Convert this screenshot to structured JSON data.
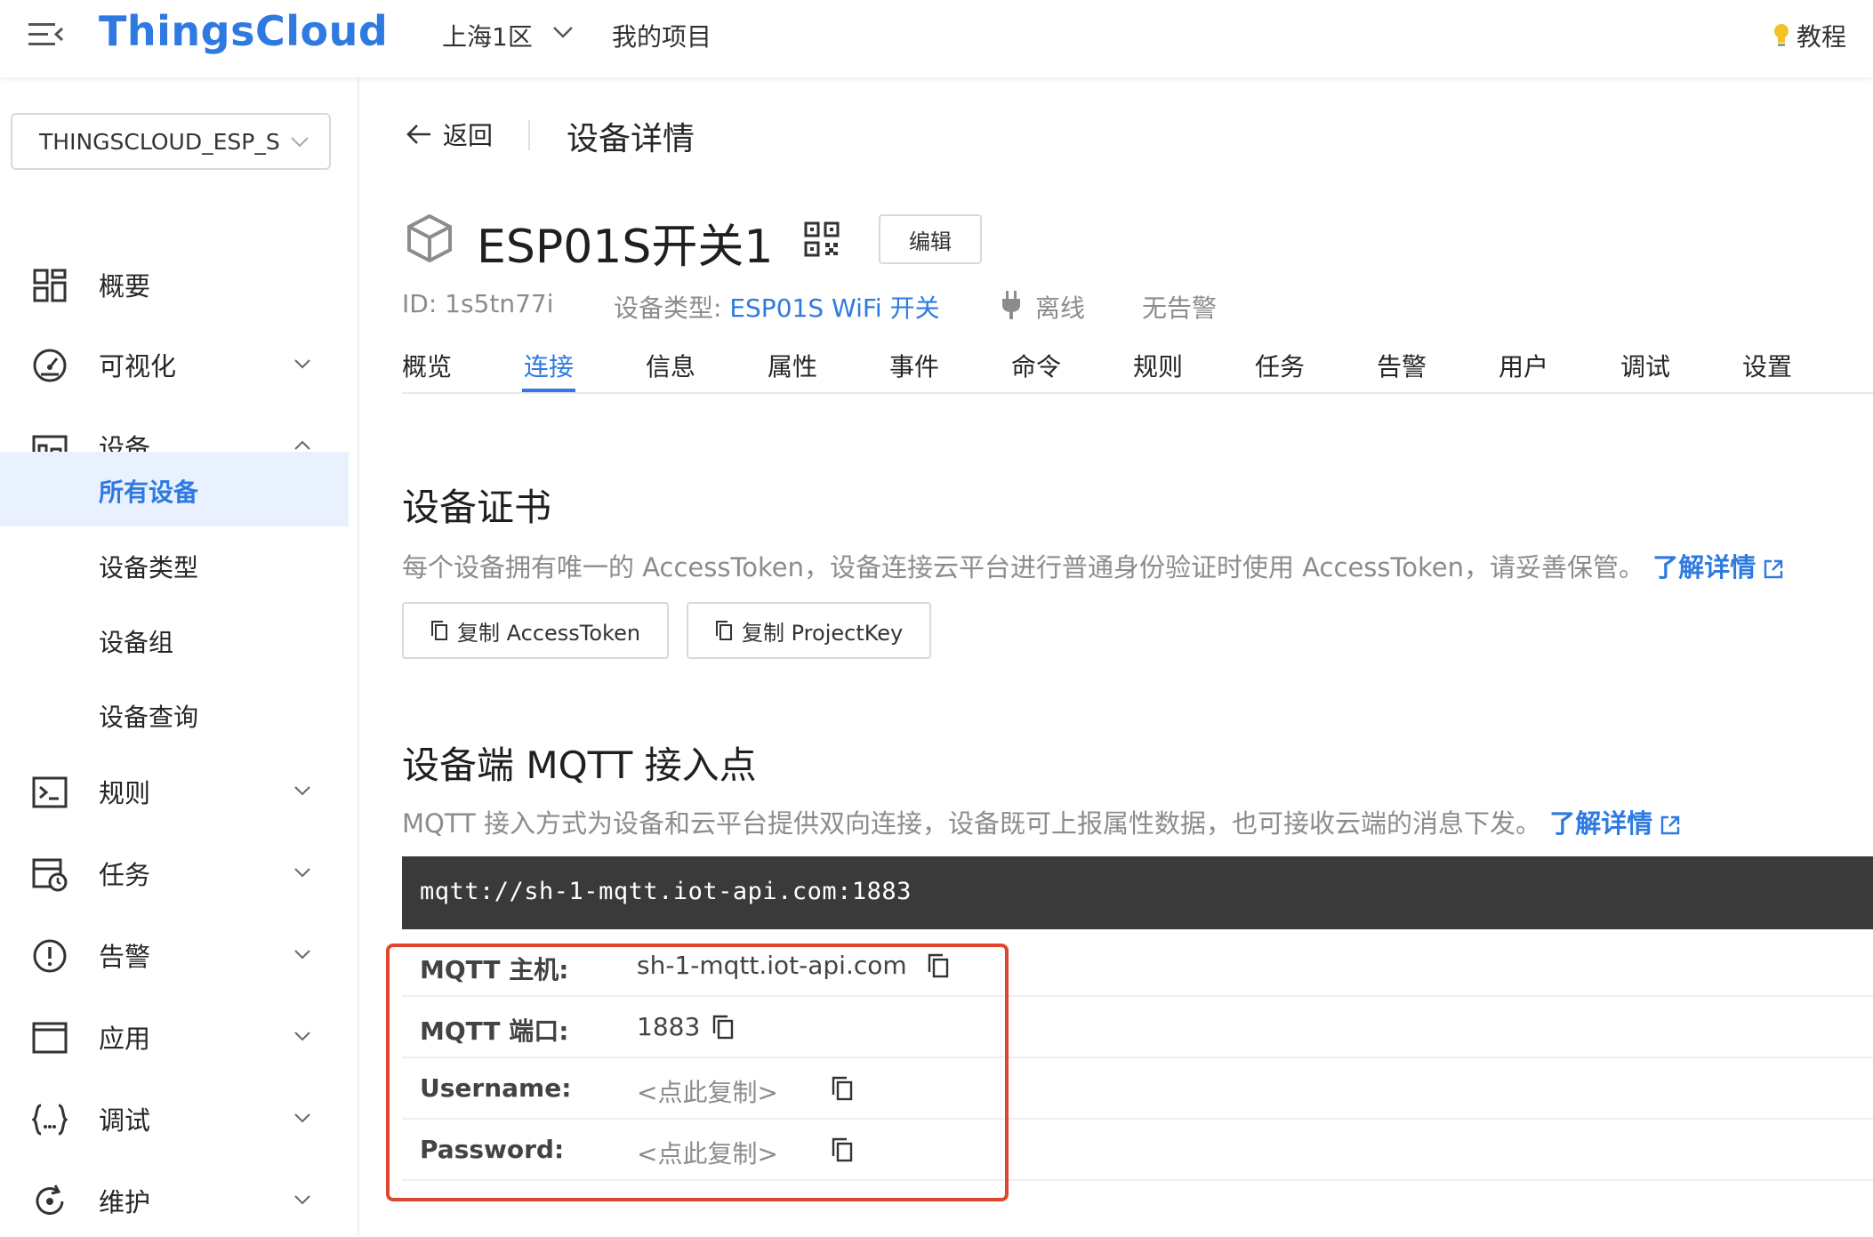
{
  "topbar": {
    "logo": "ThingsCloud",
    "region": "上海1区",
    "projects": "我的项目",
    "tutorial": "教程"
  },
  "sidebar": {
    "project_select": "THINGSCLOUD_ESP_S",
    "items": [
      {
        "label": "概要"
      },
      {
        "label": "可视化"
      },
      {
        "label": "设备"
      },
      {
        "label": "规则"
      },
      {
        "label": "任务"
      },
      {
        "label": "告警"
      },
      {
        "label": "应用"
      },
      {
        "label": "调试"
      },
      {
        "label": "维护"
      }
    ],
    "device_sub": [
      {
        "label": "所有设备"
      },
      {
        "label": "设备类型"
      },
      {
        "label": "设备组"
      },
      {
        "label": "设备查询"
      }
    ]
  },
  "header": {
    "back": "返回",
    "title": "设备详情"
  },
  "device": {
    "name": "ESP01S开关1",
    "edit": "编辑",
    "id": "ID: 1s5tn77i",
    "type_label": "设备类型:",
    "type_value": "ESP01S WiFi 开关",
    "status": "离线",
    "alarm": "无告警"
  },
  "tabs": [
    "概览",
    "连接",
    "信息",
    "属性",
    "事件",
    "命令",
    "规则",
    "任务",
    "告警",
    "用户",
    "调试",
    "设置"
  ],
  "cert": {
    "title": "设备证书",
    "desc": "每个设备拥有唯一的 AccessToken，设备连接云平台进行普通身份验证时使用 AccessToken，请妥善保管。",
    "learn_more": "了解详情",
    "copy_token": "复制 AccessToken",
    "copy_key": "复制 ProjectKey"
  },
  "mqtt": {
    "title": "设备端 MQTT 接入点",
    "desc": "MQTT 接入方式为设备和云平台提供双向连接，设备既可上报属性数据，也可接收云端的消息下发。",
    "learn_more": "了解详情",
    "url": "mqtt://sh-1-mqtt.iot-api.com:1883",
    "rows": [
      {
        "key": "MQTT 主机:",
        "value": "sh-1-mqtt.iot-api.com"
      },
      {
        "key": "MQTT 端口:",
        "value": "1883"
      },
      {
        "key": "Username:",
        "value": "<点此复制>"
      },
      {
        "key": "Password:",
        "value": "<点此复制>"
      }
    ]
  },
  "colors": {
    "primary": "#2e7ae0",
    "code_bg": "#3a3a3a",
    "highlight": "#e0452e",
    "muted": "#8c8c8c"
  }
}
